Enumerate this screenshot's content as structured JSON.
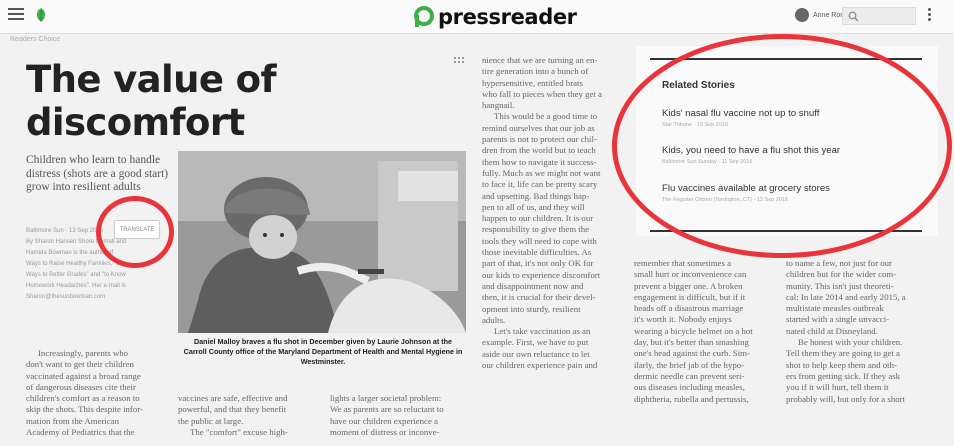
{
  "app": {
    "brand": "pressreader",
    "user_name": "Anne Ronn",
    "breadcrumb": "Readers Choice"
  },
  "article": {
    "title": "The value of discomfort",
    "deck": "Children who learn to handle distress (shots are a good start) grow into resilient adults",
    "byline": [
      "Baltimore Sun · 13 Sep 2016",
      "By Sharon Hansen Shore Nemati and",
      "Hamida Bowman is the author of",
      "Ways to Raise Healthy Families, \"15",
      "Ways to Better Grades\" and \"to Know",
      "Homework Headaches\". Her e-mail is",
      "Sharon@thesunbowman.com"
    ],
    "translate_label": "TRANSLATE",
    "col1_lines": [
      "Increasingly, parents who",
      "don't want to get their children",
      "vaccinated against a broad range",
      "of dangerous diseases cite their",
      "children's comfort as a reason to",
      "skip the shots. This despite infor-",
      "mation from the American",
      "Academy of Pediatrics that the"
    ],
    "col2_lines": [
      "vaccines are safe, effective and",
      "powerful, and that they benefit",
      "the public at large.",
      "The \"comfort\" excuse high-"
    ],
    "col3_lines": [
      "lights a larger societal problem:",
      "We as parents are so reluctant to",
      "have our children experience a",
      "moment of distress or inconve-"
    ],
    "col4_lines": [
      "nience that we are turning an en-",
      "tire generation into a bunch of",
      "hypersensitive, entitled brats",
      "who fall to pieces when they get a",
      "hangnail.",
      "This would be a good time to",
      "remind ourselves that our job as",
      "parents is not to protect our chil-",
      "dren from the world but to teach",
      "them how to navigate it success-",
      "fully. Much as we might not want",
      "to face it, life can be pretty scary",
      "and upsetting. Bad things hap-",
      "pen to all of us, and they will",
      "happen to our children. It is our",
      "responsibility to give them the",
      "tools they will need to cope with",
      "those inevitable difficulties. As",
      "part of that, it's not only OK for",
      "our kids to experience discomfort",
      "and disappointment now and",
      "then, it is crucial for their devel-",
      "opment into sturdy, resilient",
      "adults.",
      "Let's take vaccination as an",
      "example. First, we have to put",
      "aside our own reluctance to let",
      "our children experience pain and"
    ],
    "col5_lines": [
      "remember that sometimes a",
      "small hurt or inconvenience can",
      "prevent a bigger one. A broken",
      "engagement is difficult, but if it",
      "heads off a disastrous marriage",
      "it's worth it. Nobody enjoys",
      "wearing a bicycle helmet on a hot",
      "day, but it's better than smashing",
      "one's head against the curb. Sim-",
      "ilarly, the brief jab of the hypo-",
      "dermic needle can prevent seri-",
      "ous diseases including measles,",
      "diphtheria, rubella and pertussis,"
    ],
    "col6_lines": [
      "to name a few, not just for our",
      "children but for the wider com-",
      "munity. This isn't just theoreti-",
      "cal: In late 2014 and early 2015, a",
      "multistate measles outbreak",
      "started with a single unvacci-",
      "nated child at Disneyland.",
      "Be honest with your children.",
      "Tell them they are going to get a",
      "shot to help keep them and oth-",
      "ers from getting sick. If they ask",
      "you if it will hurt, tell them it",
      "probably will, but only for a short"
    ],
    "caption": "Daniel Malloy braves a flu shot in December given by Laurie Johnson at the Carroll County office of the Maryland Department of Health and Mental Hygiene in Westminster."
  },
  "related": {
    "heading": "Related Stories",
    "stories": [
      {
        "title": "Kids' nasal flu vaccine not up to snuff",
        "meta": "Star Tribune · 13 Sep 2016"
      },
      {
        "title": "Kids, you need to have a flu shot this year",
        "meta": "Baltimore Sun Sunday · 11 Sep 2016"
      },
      {
        "title": "Flu vaccines available at grocery stores",
        "meta": "The Register Citizen (Torrington, CT) · 13 Sep 2016"
      }
    ]
  },
  "colors": {
    "annotation": "#e8343a",
    "brand_green": "#3fae49"
  },
  "icons": [
    "menu-icon",
    "pressreader-leaf-icon",
    "pressreader-logo-icon",
    "search-icon",
    "more-vert-icon",
    "grip-icon"
  ]
}
